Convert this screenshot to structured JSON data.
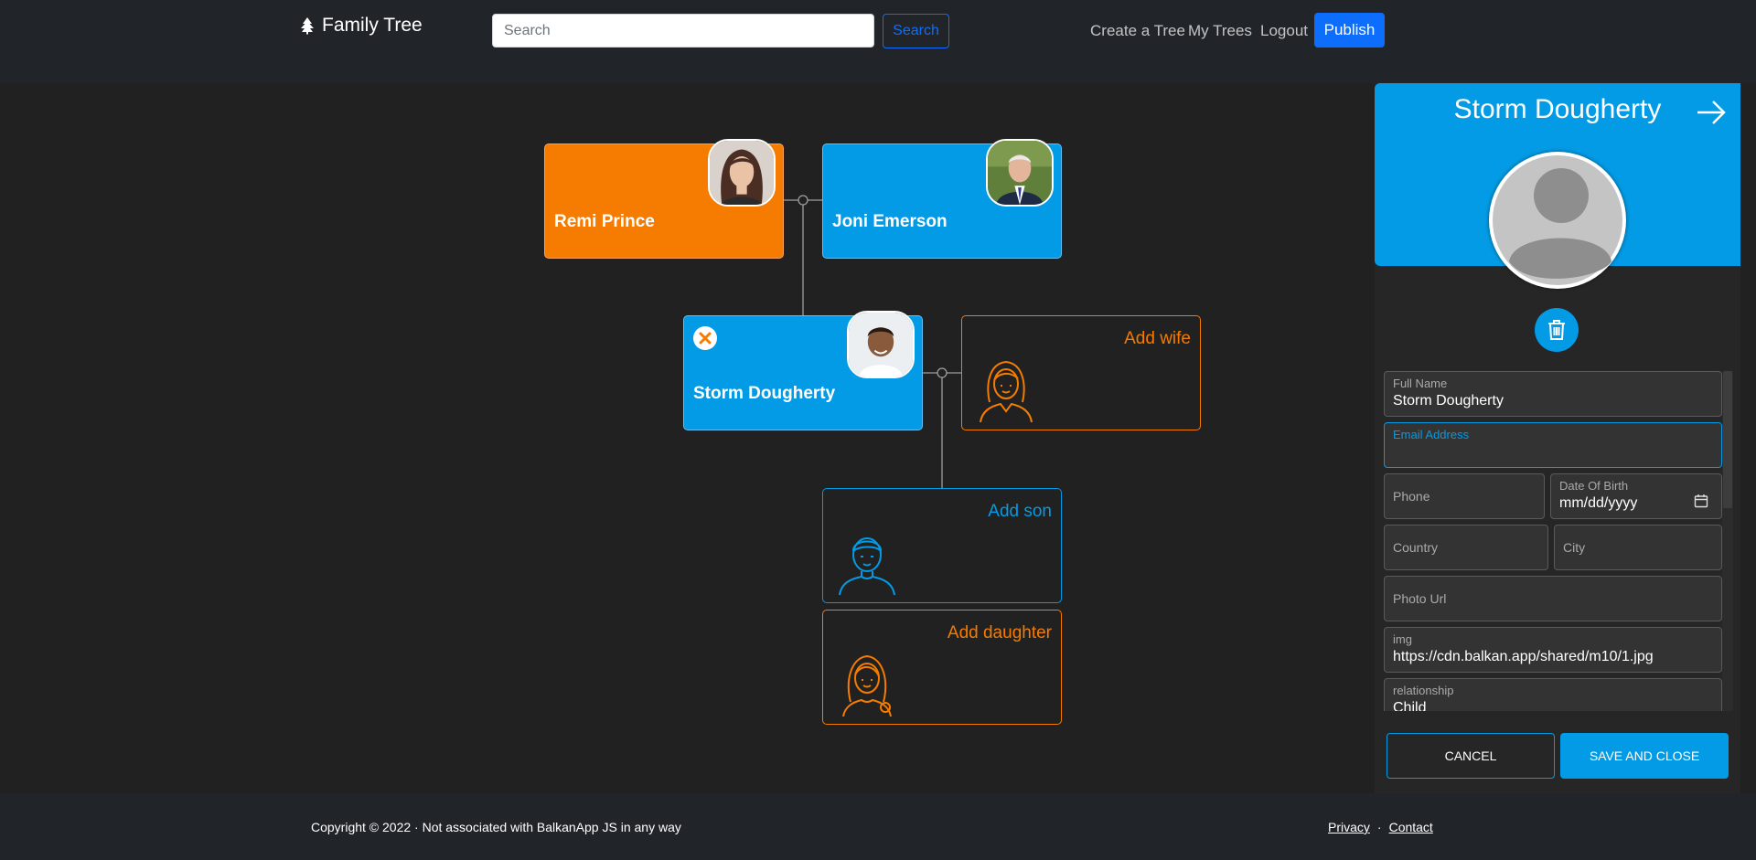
{
  "header": {
    "brand": "Family Tree",
    "search_placeholder": "Search",
    "search_button": "Search",
    "nav": [
      "Create a Tree",
      "My Trees",
      "Logout"
    ],
    "publish_button": "Publish"
  },
  "tree": {
    "nodes": [
      {
        "name": "Remi Prince",
        "gender": "female",
        "avatar": "woman-photo-icon"
      },
      {
        "name": "Joni Emerson",
        "gender": "male",
        "avatar": "man-photo-icon"
      },
      {
        "name": "Storm Dougherty",
        "gender": "male",
        "avatar": "boy-photo-icon"
      }
    ],
    "add_wife": "Add wife",
    "add_son": "Add son",
    "add_daughter": "Add daughter"
  },
  "panel": {
    "title": "Storm Dougherty",
    "fields": {
      "full_name_label": "Full Name",
      "full_name_value": "Storm Dougherty",
      "email_label": "Email Address",
      "phone_label": "Phone",
      "dob_label": "Date Of Birth",
      "dob_value": "mm/dd/yyyy",
      "country_label": "Country",
      "city_label": "City",
      "photo_url_label": "Photo Url",
      "img_label": "img",
      "img_value": "https://cdn.balkan.app/shared/m10/1.jpg",
      "relationship_label": "relationship",
      "relationship_value": "Child"
    },
    "cancel_button": "CANCEL",
    "save_button": "SAVE AND CLOSE"
  },
  "footer": {
    "copyright": "Copyright © 2022  ·  Not associated with BalkanApp JS in any way",
    "privacy": "Privacy",
    "separator": "·",
    "contact": "Contact"
  },
  "colors": {
    "female": "#f57c00",
    "male": "#039be5",
    "primary": "#0d6efd",
    "background": "#212121"
  }
}
